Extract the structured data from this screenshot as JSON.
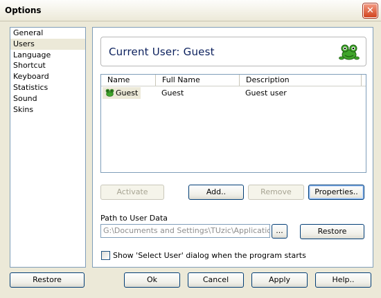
{
  "window": {
    "title": "Options",
    "close_glyph": "✕"
  },
  "nav": {
    "items": [
      {
        "label": "General",
        "selected": false
      },
      {
        "label": "Users",
        "selected": true
      },
      {
        "label": "Language",
        "selected": false
      },
      {
        "label": "Shortcut",
        "selected": false
      },
      {
        "label": "Keyboard",
        "selected": false
      },
      {
        "label": "Statistics",
        "selected": false
      },
      {
        "label": "Sound",
        "selected": false
      },
      {
        "label": "Skins",
        "selected": false
      }
    ]
  },
  "current_user": {
    "label": "Current User: Guest",
    "icon": "frog-icon",
    "icon_color": "#2e8b1e"
  },
  "user_table": {
    "columns": [
      "Name",
      "Full Name",
      "Description"
    ],
    "rows": [
      {
        "name": "Guest",
        "full_name": "Guest",
        "description": "Guest user"
      }
    ]
  },
  "buttons": {
    "activate": "Activate",
    "add": "Add..",
    "remove": "Remove",
    "properties": "Properties..",
    "browse": "...",
    "restore_path": "Restore",
    "restore": "Restore",
    "ok": "Ok",
    "cancel": "Cancel",
    "apply": "Apply",
    "help": "Help.."
  },
  "path": {
    "label": "Path to User Data",
    "value": "G:\\Documents and Settings\\TUzic\\Application Data\\"
  },
  "select_user_dialog": {
    "label": "Show 'Select User' dialog when the program starts",
    "checked": false
  },
  "colors": {
    "accent": "#003c74",
    "header_text": "#0a1f5c",
    "titlebar_close": "#d1441f"
  }
}
